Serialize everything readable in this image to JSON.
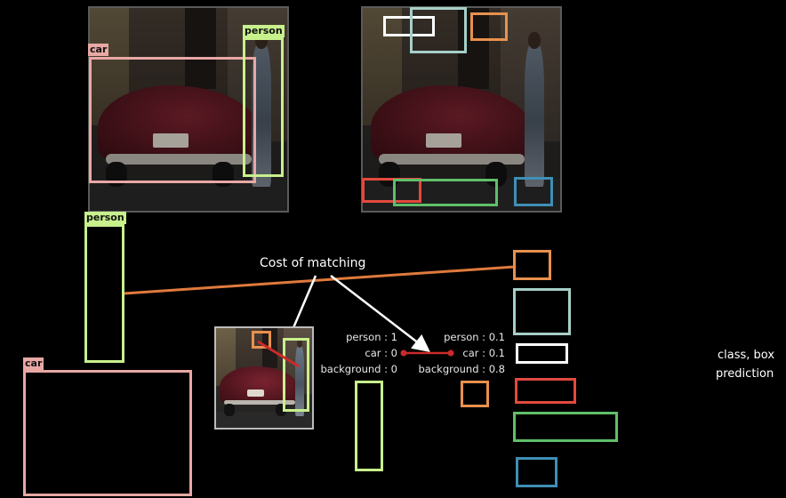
{
  "labels": {
    "person": "person",
    "car": "car"
  },
  "cost_label": "Cost of matching",
  "ground_truth_scores": {
    "person": "person : 1",
    "car": "car : 0",
    "background": "background : 0"
  },
  "prediction_scores": {
    "person": "person : 0.1",
    "car": "car : 0.1",
    "background": "background : 0.8"
  },
  "side_label": {
    "line1": "class, box",
    "line2": "prediction"
  },
  "colors": {
    "person_box": "#c8f08c",
    "car_box": "#e8a8a4",
    "orange": "#e8914e",
    "light_blue": "#a6cfc8",
    "white": "#ffffff",
    "red": "#e24a3e",
    "green": "#5fbf6a",
    "blue": "#3f8fb5",
    "match_line": "#e07a3c",
    "cost_line": "#cc2a2a"
  },
  "icons": [
    "street-photo-image",
    "street-photo-predictions-image",
    "street-photo-thumbnail-image"
  ]
}
